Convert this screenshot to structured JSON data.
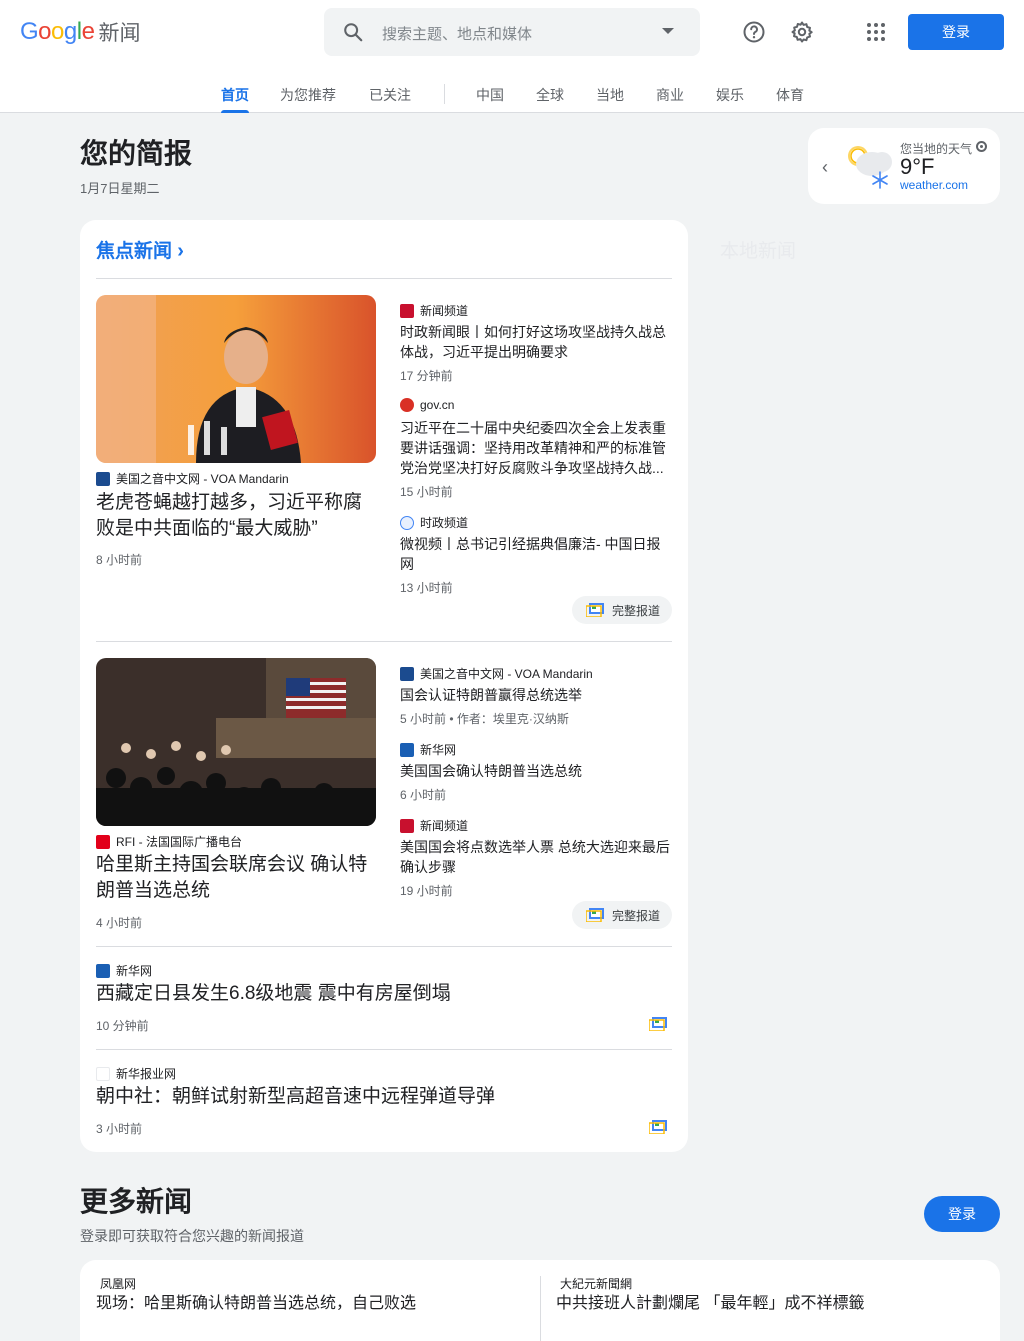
{
  "header": {
    "logo_google": "Google",
    "logo_news": "新闻",
    "search_placeholder": "搜索主题、地点和媒体",
    "login": "登录"
  },
  "nav": {
    "tabs": [
      "首页",
      "为您推荐",
      "已关注",
      "中国",
      "全球",
      "当地",
      "商业",
      "娱乐",
      "体育"
    ],
    "active_index": 0
  },
  "briefing": {
    "title": "您的简报",
    "date": "1月7日星期二"
  },
  "weather": {
    "label": "您当地的天气",
    "temp": "9°F",
    "source": "weather.com"
  },
  "local_news_title": "本地新闻",
  "headlines": {
    "title": "焦点新闻",
    "full_coverage_label": "完整报道",
    "clusters": [
      {
        "main": {
          "source": "美国之音中文网 - VOA Mandarin",
          "headline": "老虎苍蝇越打越多，习近平称腐败是中共面临的“最大威胁”",
          "time": "8 小时前"
        },
        "related": [
          {
            "source": "新闻频道",
            "headline": "时政新闻眼丨如何打好这场攻坚战持久战总体战，习近平提出明确要求",
            "time": "17 分钟前"
          },
          {
            "source": "gov.cn",
            "headline": "习近平在二十届中央纪委四次全会上发表重要讲话强调：坚持用改革精神和严的标准管党治党坚决打好反腐败斗争攻坚战持久战...",
            "time": "15 小时前"
          },
          {
            "source": "时政频道",
            "headline": "微视频丨总书记引经据典倡廉洁- 中国日报网",
            "time": "13 小时前"
          }
        ]
      },
      {
        "main": {
          "source": "RFI - 法国国际广播电台",
          "headline": "哈里斯主持国会联席会议 确认特朗普当选总统",
          "time": "4 小时前"
        },
        "related": [
          {
            "source": "美国之音中文网 - VOA Mandarin",
            "headline": "国会认证特朗普赢得总统选举",
            "time": "5 小时前 • 作者：埃里克·汉纳斯"
          },
          {
            "source": "新华网",
            "headline": "美国国会确认特朗普当选总统",
            "time": "6 小时前"
          },
          {
            "source": "新闻频道",
            "headline": "美国国会将点数选举人票 总统大选迎来最后确认步骤",
            "time": "19 小时前"
          }
        ]
      }
    ],
    "singles": [
      {
        "source": "新华网",
        "headline": "西藏定日县发生6.8级地震 震中有房屋倒塌",
        "time": "10 分钟前"
      },
      {
        "source": "新华报业网",
        "headline": "朝中社：朝鲜试射新型高超音速中远程弹道导弹",
        "time": "3 小时前"
      }
    ]
  },
  "more_news": {
    "title": "更多新闻",
    "subtitle": "登录即可获取符合您兴趣的新闻报道",
    "login": "登录",
    "items": [
      {
        "source": "凤凰网",
        "headline": "现场：哈里斯确认特朗普当选总统，自己败选"
      },
      {
        "source": "大紀元新聞網",
        "headline": "中共接班人計劃爛尾 「最年輕」成不祥標籤"
      }
    ]
  },
  "colors": {
    "accent": "#1a73e8",
    "background": "#f1f3f4"
  }
}
